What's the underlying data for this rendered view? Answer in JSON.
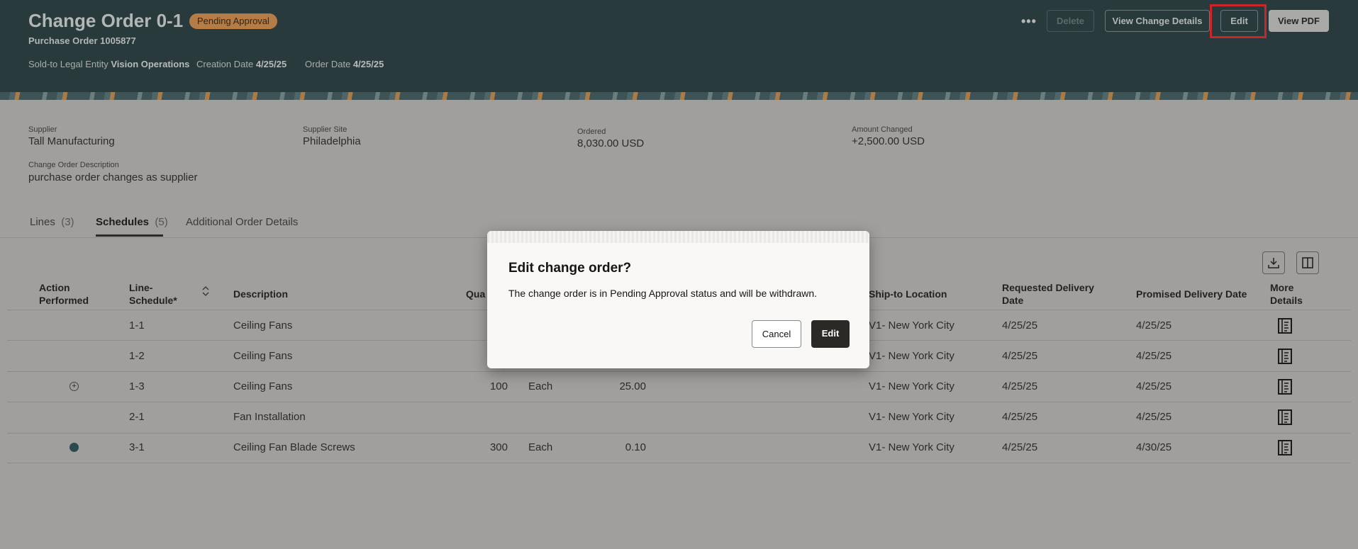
{
  "header": {
    "title": "Change Order 0-1",
    "status": "Pending Approval",
    "purchase_order": "Purchase Order 1005877",
    "meta": [
      {
        "label": "Sold-to Legal Entity",
        "value": "Vision Operations"
      },
      {
        "label": "Creation Date",
        "value": "4/25/25"
      },
      {
        "label": "Order Date",
        "value": "4/25/25"
      }
    ],
    "more_label": "•••",
    "delete_label": "Delete",
    "view_change_details_label": "View Change Details",
    "edit_label": "Edit",
    "view_pdf_label": "View PDF"
  },
  "summary": {
    "supplier_label": "Supplier",
    "supplier": "Tall Manufacturing",
    "site_label": "Supplier Site",
    "site": "Philadelphia",
    "ordered_label": "Ordered",
    "ordered": "8,030.00 USD",
    "amount_label": "Amount Changed",
    "amount": "+2,500.00 USD",
    "desc_label": "Change Order Description",
    "desc": "purchase order changes as supplier"
  },
  "tabs": [
    {
      "label": "Lines",
      "count": "(3)"
    },
    {
      "label": "Schedules",
      "count": "(5)"
    },
    {
      "label": "Additional Order Details",
      "count": ""
    }
  ],
  "table": {
    "headers": {
      "action": "Action Performed",
      "line": "Line-Schedule*",
      "description": "Description",
      "quantity": "Qua",
      "ship_to": "Ship-to Location",
      "requested": "Requested Delivery Date",
      "promised": "Promised Delivery Date",
      "more": "More Details"
    },
    "rows": [
      {
        "action": "",
        "line": "1-1",
        "description": "Ceiling Fans",
        "qty": "",
        "uom": "",
        "price": "",
        "ship_to": "V1- New York City",
        "requested": "4/25/25",
        "promised": "4/25/25"
      },
      {
        "action": "",
        "line": "1-2",
        "description": "Ceiling Fans",
        "qty": "",
        "uom": "",
        "price": "",
        "ship_to": "V1- New York City",
        "requested": "4/25/25",
        "promised": "4/25/25"
      },
      {
        "action": "added",
        "line": "1-3",
        "description": "Ceiling Fans",
        "qty": "100",
        "uom": "Each",
        "price": "25.00",
        "ship_to": "V1- New York City",
        "requested": "4/25/25",
        "promised": "4/25/25"
      },
      {
        "action": "",
        "line": "2-1",
        "description": "Fan Installation",
        "qty": "",
        "uom": "",
        "price": "",
        "ship_to": "V1- New York City",
        "requested": "4/25/25",
        "promised": "4/25/25"
      },
      {
        "action": "changed",
        "line": "3-1",
        "description": "Ceiling Fan Blade Screws",
        "qty": "300",
        "uom": "Each",
        "price": "0.10",
        "ship_to": "V1- New York City",
        "requested": "4/25/25",
        "promised": "4/30/25"
      }
    ]
  },
  "dialog": {
    "title": "Edit change order?",
    "message": "The change order is in Pending Approval status and will be withdrawn.",
    "cancel_label": "Cancel",
    "edit_label": "Edit"
  }
}
